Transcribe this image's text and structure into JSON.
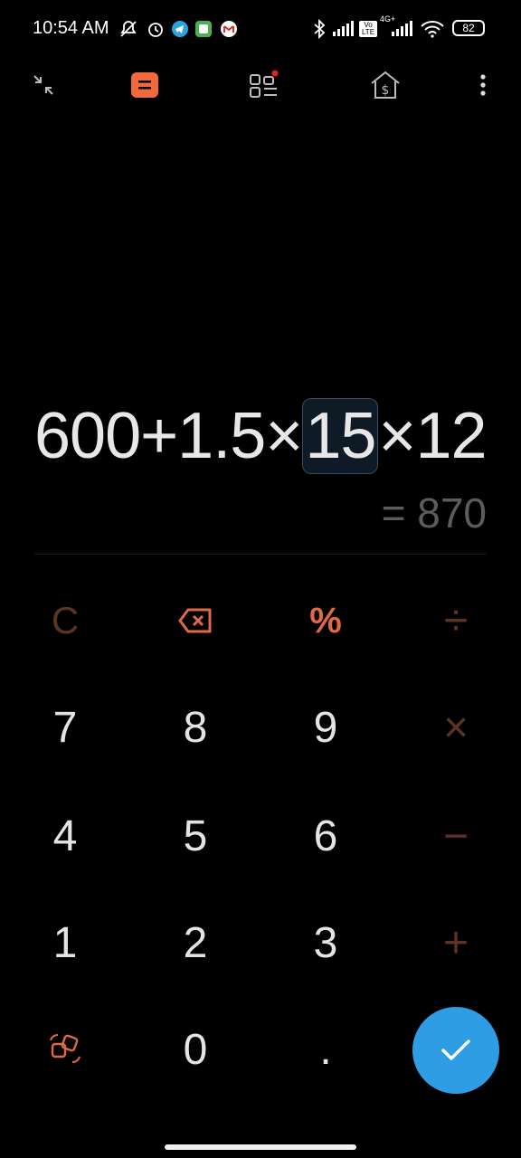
{
  "status_bar": {
    "time": "10:54 AM",
    "battery": "82",
    "network": "4G+",
    "volte": "Vo LTE"
  },
  "toolbar": {
    "icons": [
      "collapse-icon",
      "calculator-icon",
      "tools-icon",
      "currency-icon",
      "more-icon"
    ],
    "notification_dot_color": "#e0221b",
    "active_color": "#f26a3b"
  },
  "expression": {
    "before": "600+1.5×",
    "highlighted": "15",
    "after": "×12"
  },
  "result": "= 870",
  "keypad": {
    "row1": [
      "C",
      "⌫",
      "%",
      "÷"
    ],
    "row2": [
      "7",
      "8",
      "9",
      "×"
    ],
    "row3": [
      "4",
      "5",
      "6",
      "−"
    ],
    "row4": [
      "1",
      "2",
      "3",
      "+"
    ],
    "row5": [
      "⇄",
      "0",
      ".",
      "✓"
    ]
  },
  "colors": {
    "accent": "#e06a43",
    "operator_dim": "#5b3325",
    "fab": "#2e9de3"
  }
}
